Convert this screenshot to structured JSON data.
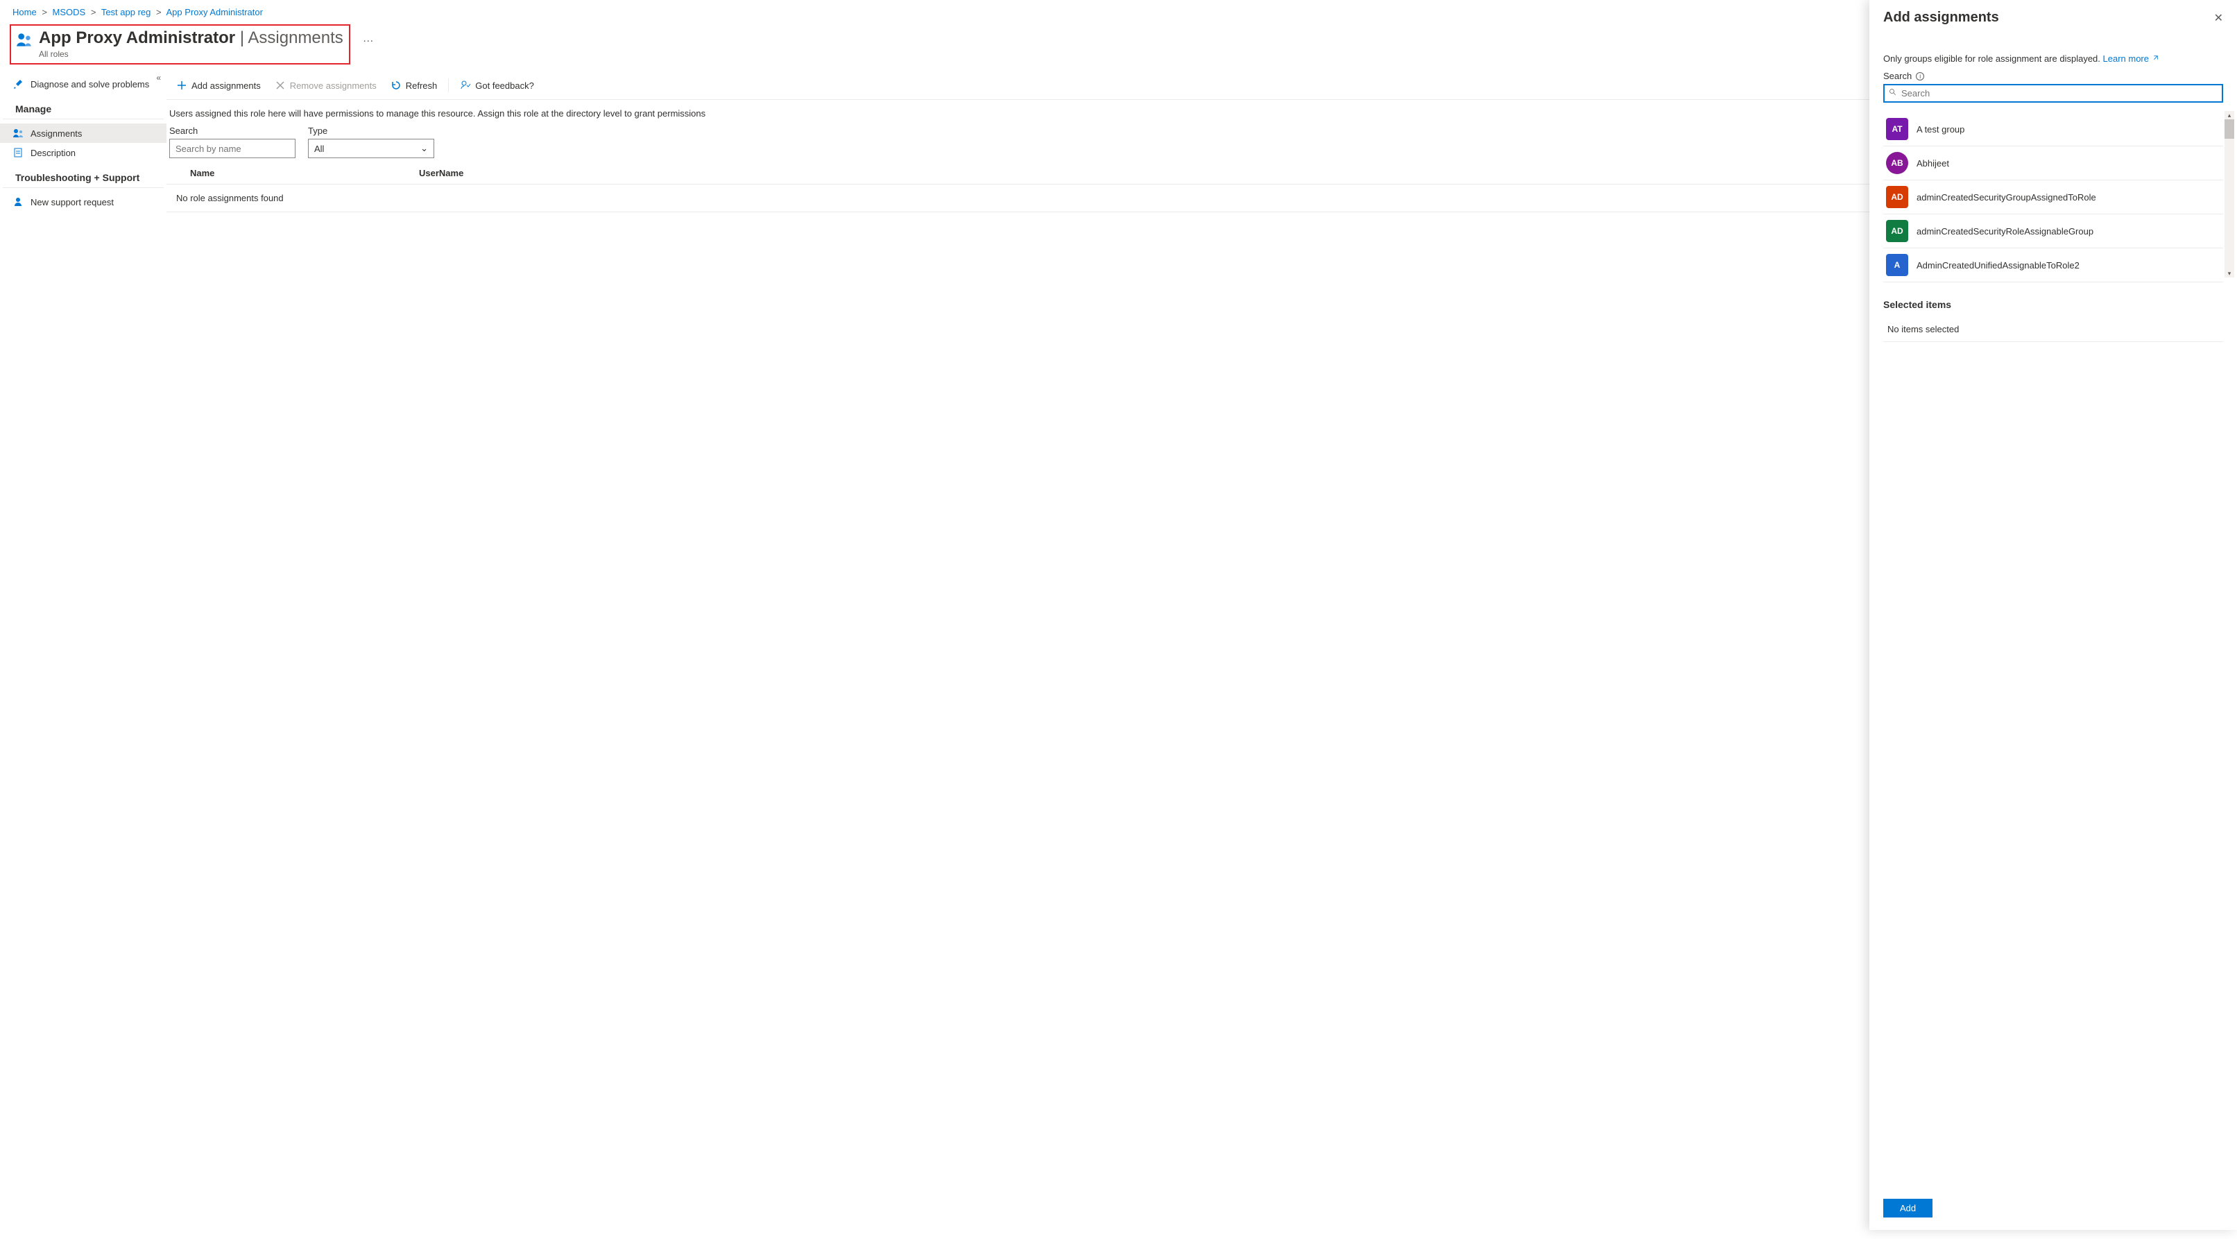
{
  "breadcrumb": [
    {
      "label": "Home"
    },
    {
      "label": "MSODS"
    },
    {
      "label": "Test app reg"
    },
    {
      "label": "App Proxy Administrator"
    }
  ],
  "header": {
    "title": "App Proxy Administrator",
    "suffix": "| Assignments",
    "subtitle": "All roles"
  },
  "sidebar": {
    "diagnose": "Diagnose and solve problems",
    "manage_header": "Manage",
    "assignments": "Assignments",
    "description": "Description",
    "troubleshoot_header": "Troubleshooting + Support",
    "support": "New support request"
  },
  "toolbar": {
    "add": "Add assignments",
    "remove": "Remove assignments",
    "refresh": "Refresh",
    "feedback": "Got feedback?"
  },
  "description_text": "Users assigned this role here will have permissions to manage this resource. Assign this role at the directory level to grant permissions",
  "filters": {
    "search_label": "Search",
    "search_placeholder": "Search by name",
    "type_label": "Type",
    "type_value": "All"
  },
  "table": {
    "col_name": "Name",
    "col_username": "UserName",
    "empty": "No role assignments found"
  },
  "panel": {
    "title": "Add assignments",
    "info": "Only groups eligible for role assignment are displayed.",
    "learn_more": "Learn more",
    "search_label": "Search",
    "search_placeholder": "Search",
    "items": [
      {
        "initials": "AT",
        "name": "A test group",
        "bg": "#7719aa",
        "shape": "square"
      },
      {
        "initials": "AB",
        "name": "Abhijeet",
        "bg": "#881798",
        "shape": "circle"
      },
      {
        "initials": "AD",
        "name": "adminCreatedSecurityGroupAssignedToRole",
        "bg": "#d83b01",
        "shape": "square"
      },
      {
        "initials": "AD",
        "name": "adminCreatedSecurityRoleAssignableGroup",
        "bg": "#107c41",
        "shape": "square"
      },
      {
        "initials": "A",
        "name": "AdminCreatedUnifiedAssignableToRole2",
        "bg": "#2564cf",
        "shape": "square"
      }
    ],
    "selected_header": "Selected items",
    "no_selected": "No items selected",
    "add_btn": "Add"
  }
}
